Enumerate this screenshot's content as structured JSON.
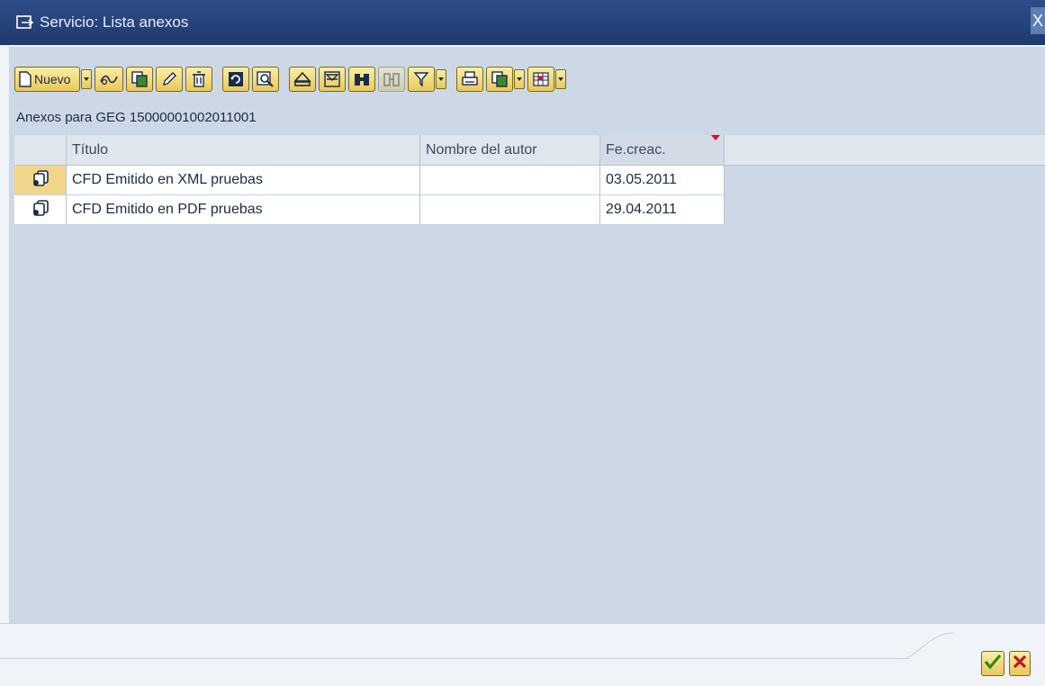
{
  "window": {
    "title": "Servicio: Lista anexos",
    "close_glyph": "X"
  },
  "toolbar": {
    "new_label": "Nuevo",
    "buttons": [
      "new-doc-icon",
      "display-icon",
      "copy-icon",
      "edit-pencil-icon",
      "delete-icon",
      "refresh-icon",
      "details-icon",
      "sort-ascending-icon",
      "filter-icon",
      "find-icon",
      "find-next-icon",
      "set-filter-icon",
      "print-icon",
      "export-icon",
      "layout-icon"
    ]
  },
  "caption": "Anexos para GEG 15000001002011001",
  "table": {
    "columns": [
      "Título",
      "Nombre del autor",
      "Fe.creac."
    ],
    "rows": [
      {
        "title": "CFD Emitido en XML pruebas",
        "author": "",
        "date": "03.05.2011"
      },
      {
        "title": "CFD Emitido en PDF pruebas",
        "author": "",
        "date": "29.04.2011"
      }
    ]
  },
  "footer": {
    "confirm_icon": "check-icon",
    "cancel_icon": "cancel-icon"
  },
  "colors": {
    "titlebar": "#1e3a70",
    "background": "#ccd8e6",
    "button": "#e8c85a",
    "sort_marker": "#d8102a"
  }
}
